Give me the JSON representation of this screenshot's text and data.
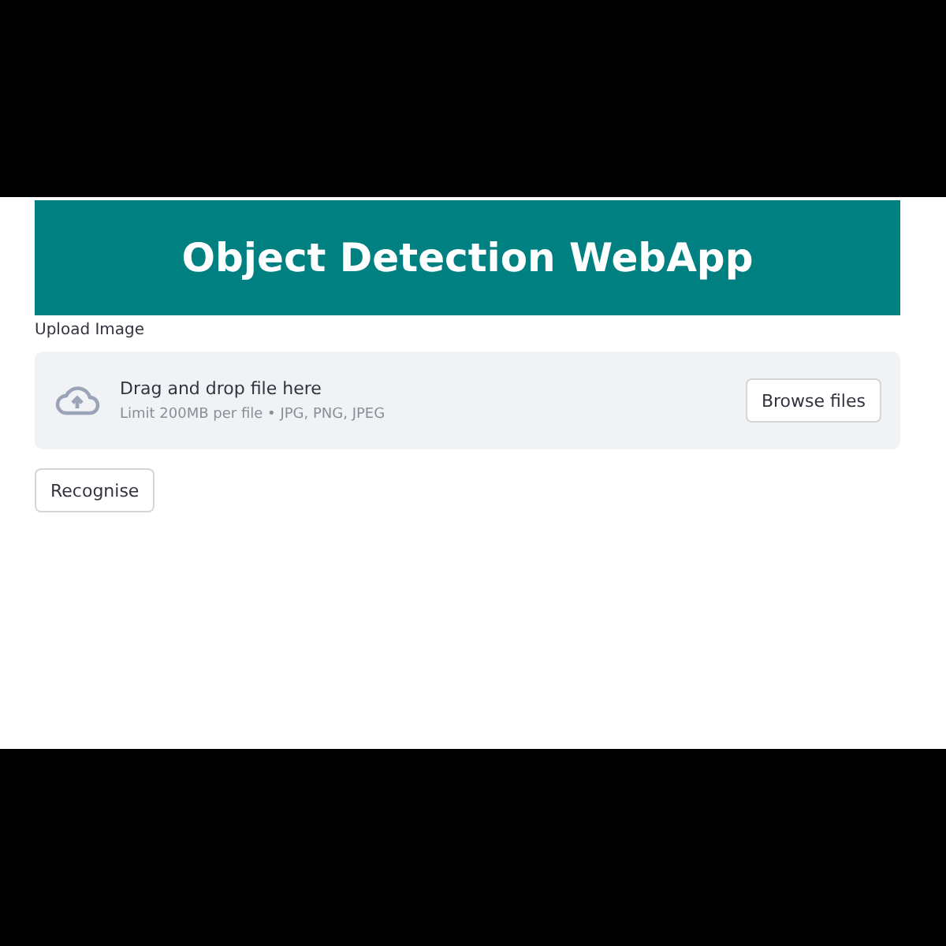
{
  "header": {
    "title": "Object Detection WebApp"
  },
  "uploader": {
    "label": "Upload Image",
    "instruction": "Drag and drop file here",
    "limits": "Limit 200MB per file • JPG, PNG, JPEG",
    "button": "Browse files"
  },
  "actions": [
    {
      "label": "Recognise"
    }
  ]
}
